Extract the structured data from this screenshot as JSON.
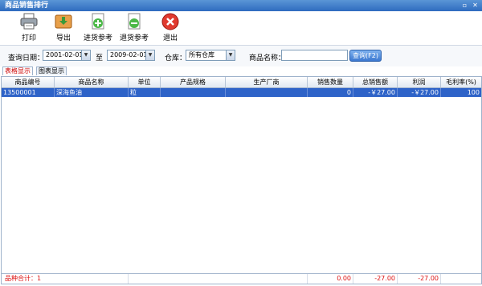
{
  "window": {
    "title": "商品销售排行"
  },
  "toolbar": {
    "print": "打印",
    "export": "导出",
    "purchase_ref": "进货参考",
    "return_ref": "退货参考",
    "exit": "退出"
  },
  "filters": {
    "date_label": "查询日期：",
    "date_from": "2001-02-01",
    "to_label": "至",
    "date_to": "2009-02-01",
    "warehouse_label": "仓库：",
    "warehouse_value": "所有仓库",
    "product_name_label": "商品名称：",
    "product_name_value": "",
    "query_button": "查询(F2)"
  },
  "tabs": {
    "table": "表格显示",
    "chart": "图表显示"
  },
  "table": {
    "columns": [
      "商品编号",
      "商品名称",
      "单位",
      "产品规格",
      "生产厂商",
      "销售数量",
      "总销售额",
      "利润",
      "毛利率(%)"
    ],
    "rows": [
      {
        "code": "13500001",
        "name": "深海鱼油",
        "unit": "粒",
        "spec": "",
        "maker": "",
        "qty": "0",
        "total": "-￥27.00",
        "profit": "-￥27.00",
        "margin": "100"
      }
    ],
    "footer": {
      "count_label": "品种合计：1",
      "qty": "0.00",
      "total": "-27.00",
      "profit": "-27.00"
    }
  },
  "colors": {
    "title_bar": "#2e6bbf",
    "selected_row": "#2e63c8",
    "footer_text": "#dd1111"
  }
}
